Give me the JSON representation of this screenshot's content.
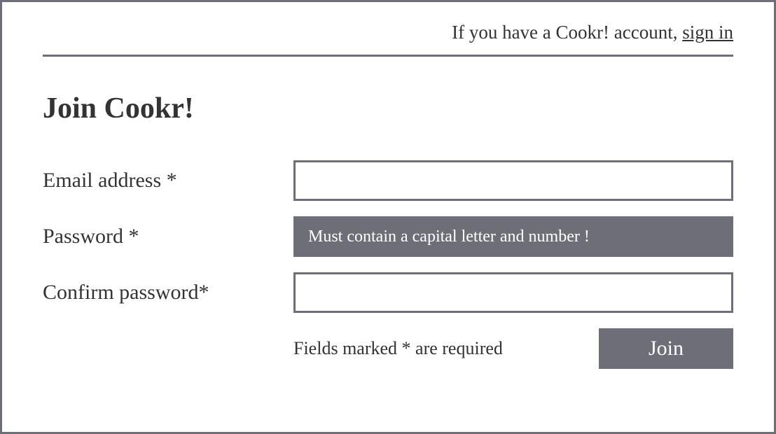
{
  "header": {
    "existing_account_prefix": "If you have a Cookr! account, ",
    "sign_in_label": "sign in"
  },
  "title": "Join Cookr!",
  "form": {
    "email": {
      "label": "Email address *",
      "value": ""
    },
    "password": {
      "label": "Password *",
      "placeholder": "Must contain a capital letter and number !",
      "value": ""
    },
    "confirm_password": {
      "label": "Confirm password*",
      "value": ""
    },
    "required_note": "Fields marked * are required",
    "submit_label": "Join"
  }
}
